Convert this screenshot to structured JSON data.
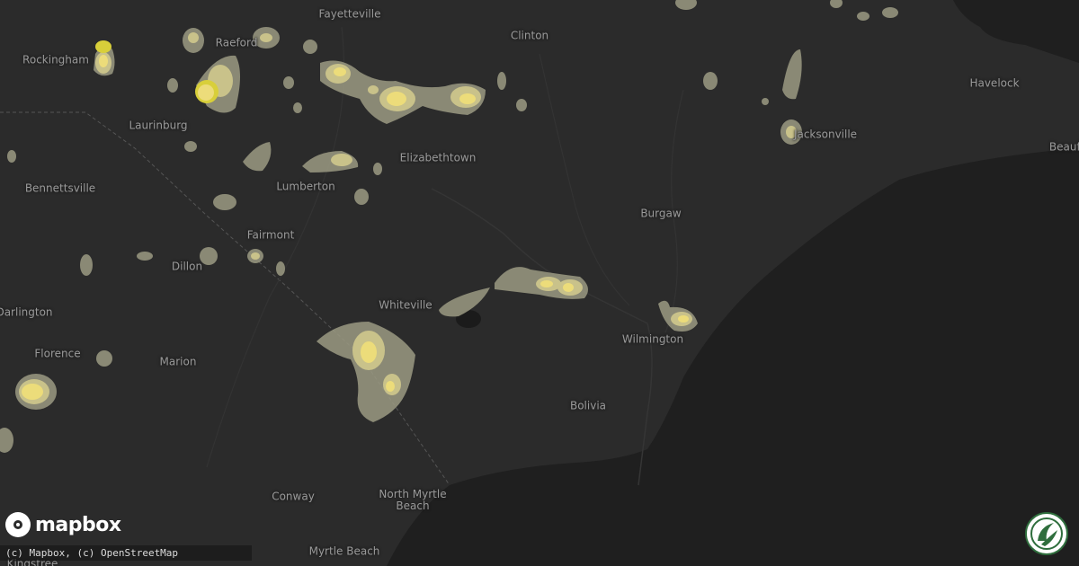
{
  "map": {
    "cities": [
      {
        "id": "fayetteville",
        "name": "Fayetteville"
      },
      {
        "id": "raeford",
        "name": "Raeford"
      },
      {
        "id": "clinton",
        "name": "Clinton"
      },
      {
        "id": "rockingham",
        "name": "Rockingham"
      },
      {
        "id": "laurinburg",
        "name": "Laurinburg"
      },
      {
        "id": "havelock",
        "name": "Havelock"
      },
      {
        "id": "jacksonville",
        "name": "Jacksonville"
      },
      {
        "id": "beaufort",
        "name": "Beaufo"
      },
      {
        "id": "bennettsville",
        "name": "Bennettsville"
      },
      {
        "id": "lumberton",
        "name": "Lumberton"
      },
      {
        "id": "elizabethtown",
        "name": "Elizabethtown"
      },
      {
        "id": "burgaw",
        "name": "Burgaw"
      },
      {
        "id": "fairmont",
        "name": "Fairmont"
      },
      {
        "id": "dillon",
        "name": "Dillon"
      },
      {
        "id": "darlington",
        "name": "Darlington"
      },
      {
        "id": "whiteville",
        "name": "Whiteville"
      },
      {
        "id": "wilmington",
        "name": "Wilmington"
      },
      {
        "id": "florence",
        "name": "Florence"
      },
      {
        "id": "marion",
        "name": "Marion"
      },
      {
        "id": "bolivia",
        "name": "Bolivia"
      },
      {
        "id": "conway",
        "name": "Conway"
      },
      {
        "id": "north-myrtle-beach",
        "name": "North Myrtle\nBeach"
      },
      {
        "id": "myrtle-beach",
        "name": "Myrtle Beach"
      },
      {
        "id": "kingstree",
        "name": "Kingstree"
      }
    ],
    "attribution": "(c) Mapbox, (c) OpenStreetMap",
    "logo_text": "mapbox",
    "colors": {
      "land": "#2b2b2b",
      "ocean": "#1f1f1f",
      "hail_outer": "#9b9a82",
      "hail_mid": "#c9c28a",
      "hail_inner": "#ecdc7a",
      "hail_core": "#d8cf3a"
    },
    "icons": [
      "mapbox-logo-icon",
      "hail-badge-icon"
    ]
  }
}
